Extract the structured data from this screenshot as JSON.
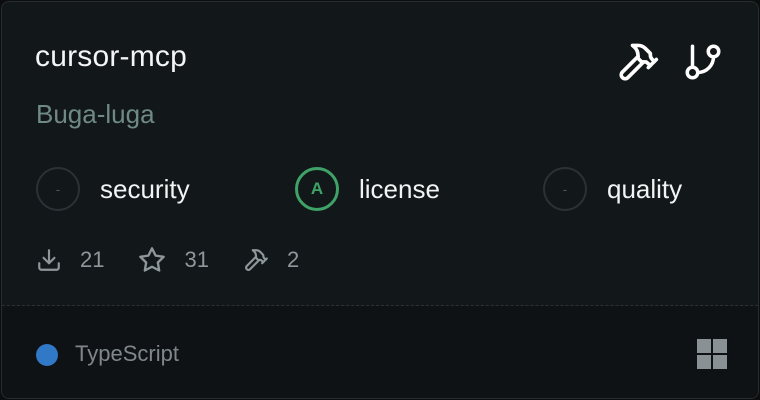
{
  "card": {
    "title": "cursor-mcp",
    "author": "Buga-luga",
    "header_icons": [
      "hammer-icon",
      "git-branch-icon"
    ],
    "scores": [
      {
        "key": "security",
        "label": "security",
        "grade": "-",
        "status": "unrated"
      },
      {
        "key": "license",
        "label": "license",
        "grade": "A",
        "status": "good"
      },
      {
        "key": "quality",
        "label": "quality",
        "grade": "-",
        "status": "unrated"
      }
    ],
    "stats": {
      "downloads": "21",
      "stars": "31",
      "tools": "2"
    },
    "footer": {
      "language": "TypeScript",
      "language_color": "#3178c6",
      "platform_icon": "windows-icon"
    }
  },
  "colors": {
    "background": "#121719",
    "good": "#3fa367",
    "author": "#6f8a84"
  }
}
